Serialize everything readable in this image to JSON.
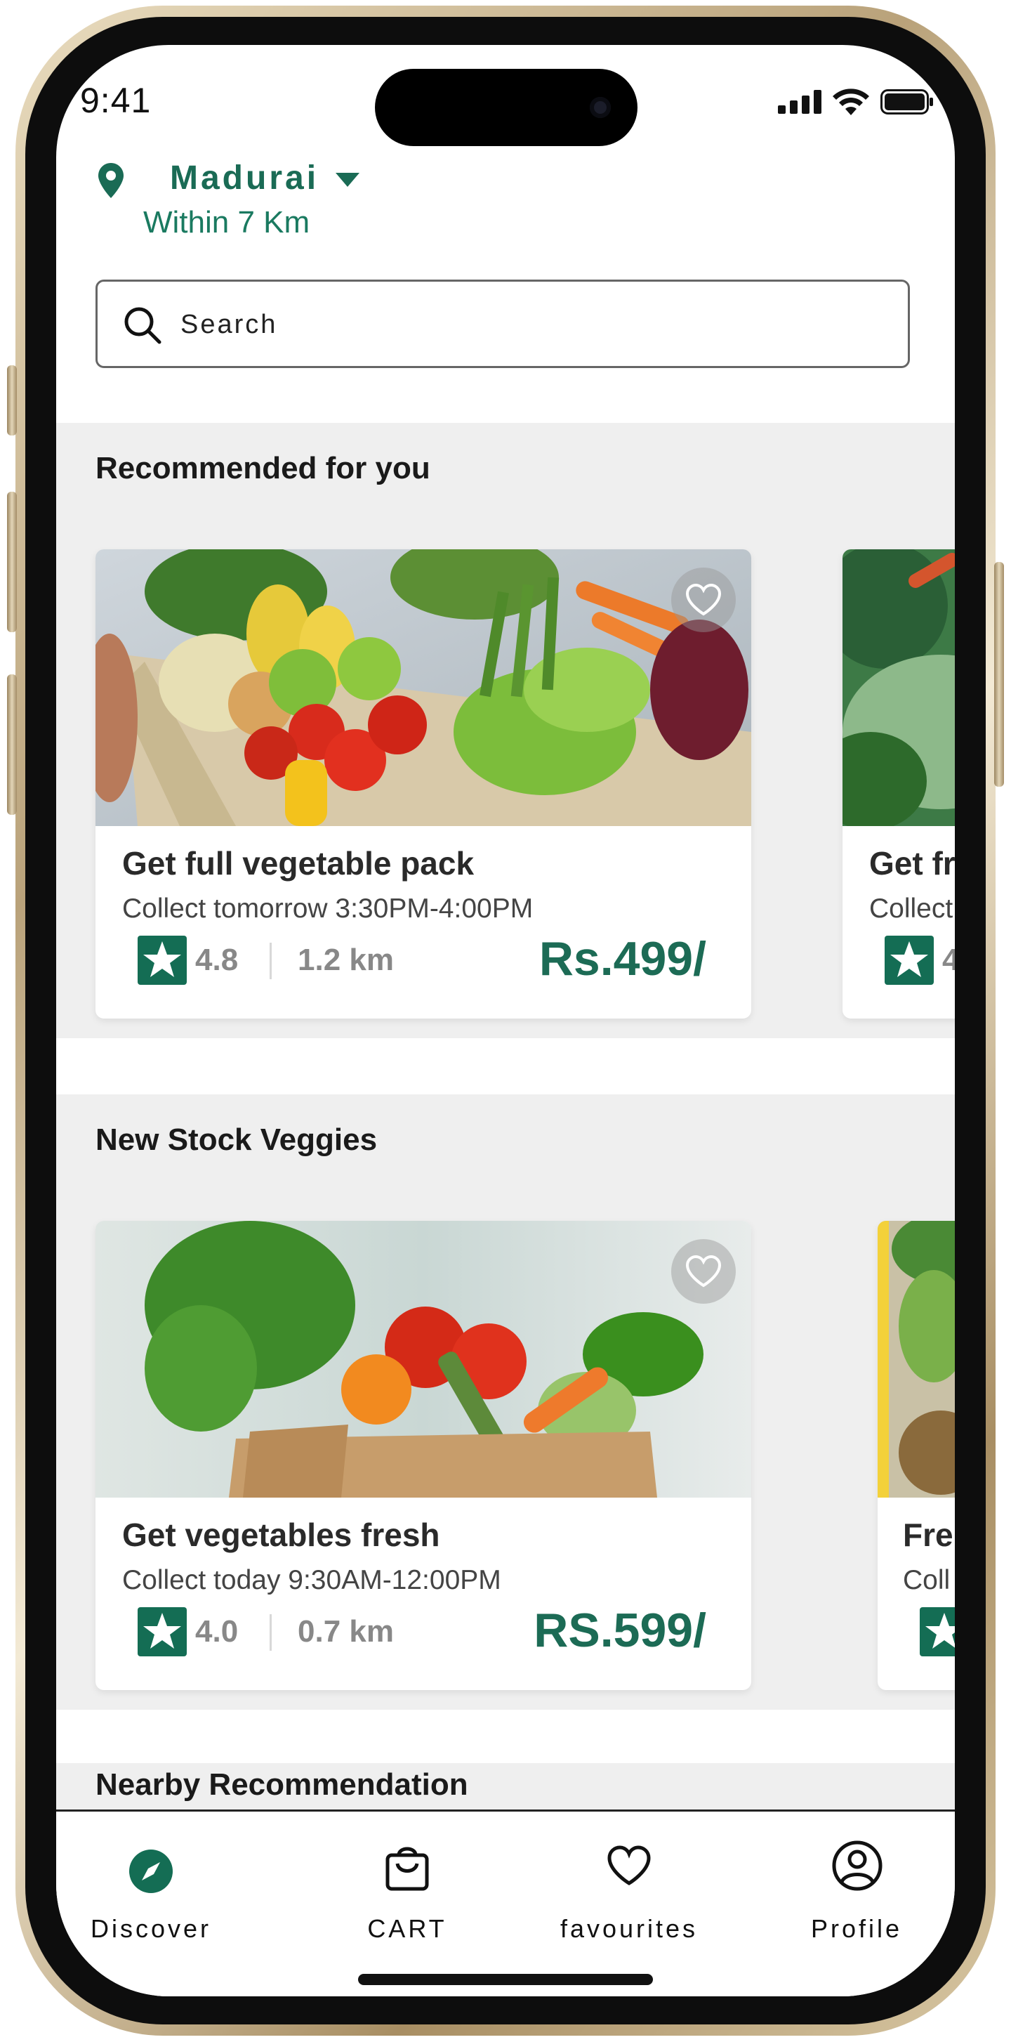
{
  "status_bar": {
    "time": "9:41"
  },
  "location": {
    "city": "Madurai",
    "radius": "Within 7 Km"
  },
  "search": {
    "placeholder": "Search"
  },
  "sections": {
    "recommended": {
      "title": "Recommended for  you",
      "cards": [
        {
          "title": "Get full vegetable pack",
          "subtitle": "Collect tomorrow 3:30PM-4:00PM",
          "rating": "4.8",
          "distance": "1.2 km",
          "price": "Rs.499/"
        },
        {
          "title": "Get fr",
          "subtitle": "Collect",
          "rating": "4"
        }
      ]
    },
    "new_stock": {
      "title": "New Stock Veggies",
      "cards": [
        {
          "title": "Get vegetables fresh",
          "subtitle": "Collect today 9:30AM-12:00PM",
          "rating": "4.0",
          "distance": "0.7 km",
          "price": "RS.599/"
        },
        {
          "title": "Fre",
          "subtitle": "Coll"
        }
      ]
    },
    "nearby": {
      "title": "Nearby Recommendation"
    }
  },
  "bottom_nav": {
    "items": [
      {
        "label": "Discover",
        "icon": "compass-icon",
        "active": true
      },
      {
        "label": "CART",
        "icon": "bag-icon"
      },
      {
        "label": "favourites",
        "icon": "heart-icon"
      },
      {
        "label": "Profile",
        "icon": "profile-icon"
      }
    ]
  },
  "colors": {
    "accent": "#146d54",
    "price": "#1c6b55",
    "section_bg": "#efefef"
  }
}
